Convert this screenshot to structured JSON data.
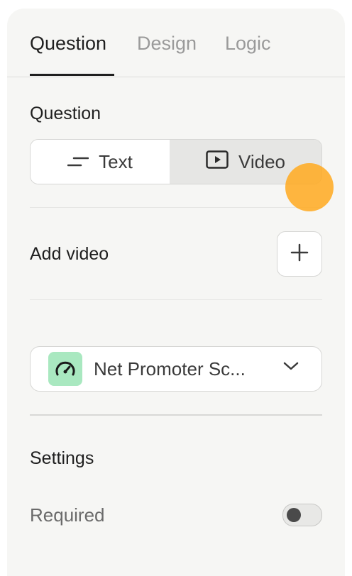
{
  "tabs": [
    {
      "label": "Question",
      "active": true
    },
    {
      "label": "Design",
      "active": false
    },
    {
      "label": "Logic",
      "active": false
    }
  ],
  "question_section": {
    "title": "Question",
    "segments": [
      {
        "label": "Text",
        "icon": "text-lines-icon",
        "selected": false
      },
      {
        "label": "Video",
        "icon": "video-play-icon",
        "selected": true
      }
    ]
  },
  "add_video": {
    "label": "Add video",
    "button_icon": "plus-icon"
  },
  "question_type": {
    "label": "Net Promoter Sc...",
    "icon": "gauge-icon",
    "icon_bg": "#a9e8c0",
    "chevron": "chevron-down-icon"
  },
  "settings": {
    "title": "Settings",
    "required_label": "Required",
    "required_on": false
  },
  "colors": {
    "panel_bg": "#f6f6f4",
    "cursor_highlight": "#ffa91f"
  }
}
